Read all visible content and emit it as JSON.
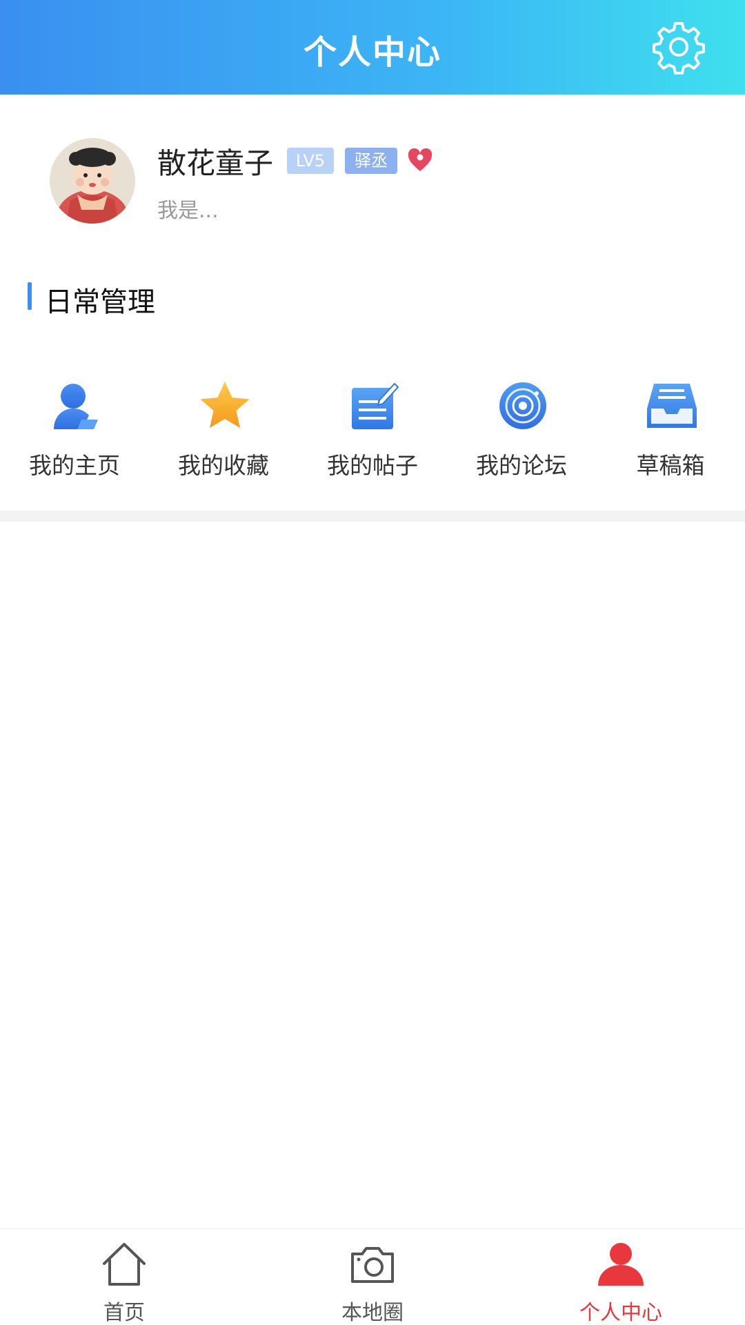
{
  "header": {
    "title": "个人中心",
    "settings_icon": "gear-icon"
  },
  "profile": {
    "username": "散花童子",
    "level_badge": "LV5",
    "role_badge": "驿丞",
    "signature": "我是...",
    "heart_icon": "heart-icon"
  },
  "section": {
    "title": "日常管理"
  },
  "grid": [
    {
      "label": "我的主页",
      "icon": "user-profile-icon"
    },
    {
      "label": "我的收藏",
      "icon": "star-icon"
    },
    {
      "label": "我的帖子",
      "icon": "note-edit-icon"
    },
    {
      "label": "我的论坛",
      "icon": "forum-target-icon"
    },
    {
      "label": "草稿箱",
      "icon": "inbox-tray-icon"
    }
  ],
  "bottom_nav": [
    {
      "label": "首页",
      "icon": "home-icon",
      "active": false
    },
    {
      "label": "本地圈",
      "icon": "camera-icon",
      "active": false
    },
    {
      "label": "个人中心",
      "icon": "user-icon",
      "active": true
    }
  ],
  "colors": {
    "accent": "#3a8ff0",
    "active_tab": "#e8383d",
    "heart": "#e84560",
    "star": "#f7a82a"
  }
}
